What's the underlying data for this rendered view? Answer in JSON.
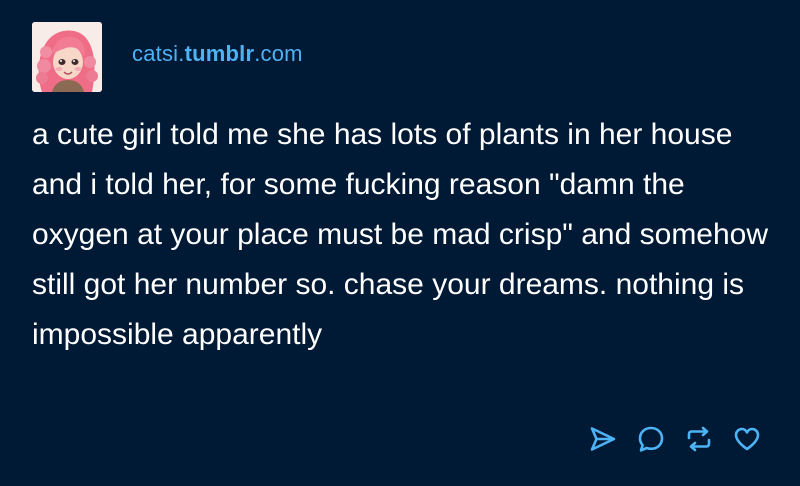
{
  "post": {
    "blog_name_prefix": "catsi.",
    "blog_name_strong": "tumblr",
    "blog_name_suffix": ".com",
    "avatar_icon": "avatar-illustration",
    "body": "a cute girl told me she has lots of plants in her house and i told her, for some fucking reason \"damn the oxygen at your place must be mad crisp\" and somehow still got her number so. chase your dreams. nothing is impossible apparently"
  },
  "actions": {
    "share_icon": "share-icon",
    "reply_icon": "reply-icon",
    "reblog_icon": "reblog-icon",
    "like_icon": "heart-icon"
  },
  "colors": {
    "background": "#001935",
    "blog_link": "#4eb3f5",
    "text": "#ffffff",
    "icon": "#4eb3f5"
  }
}
